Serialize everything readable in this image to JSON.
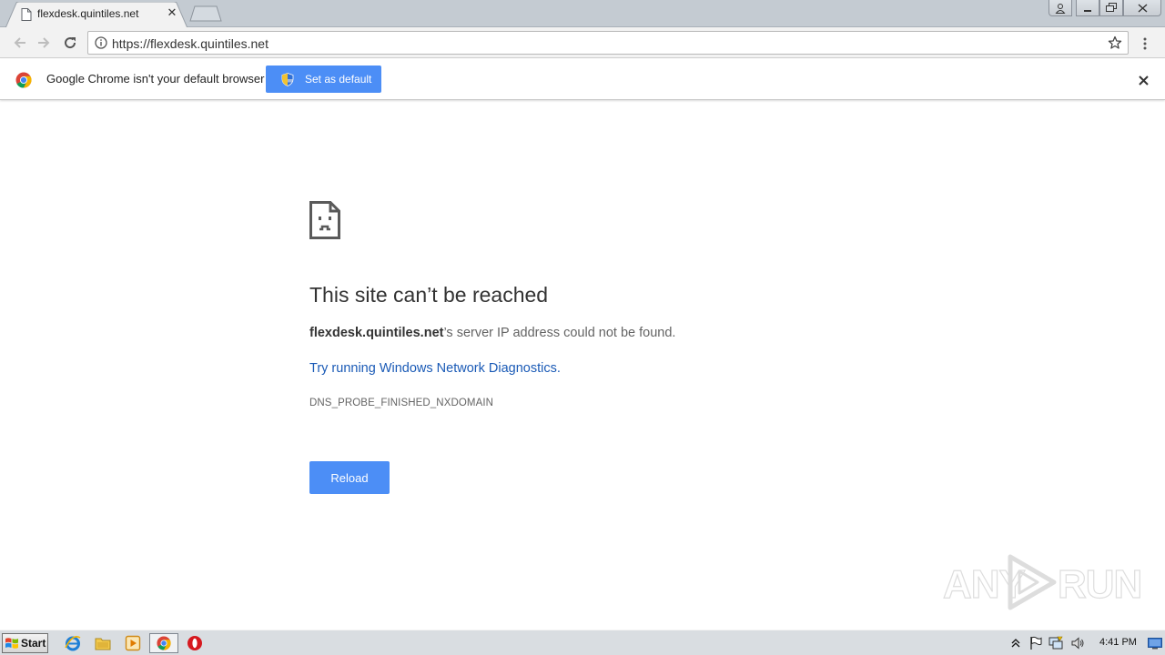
{
  "browser": {
    "tab": {
      "title": "flexdesk.quintiles.net",
      "close_glyph": "✕",
      "icon": "document-icon"
    },
    "new_tab_icon": "new-tab-icon",
    "address_bar": {
      "url": "https://flexdesk.quintiles.net",
      "security_icon": "info-icon",
      "bookmark_icon": "star-icon"
    },
    "window_controls": [
      "user-icon",
      "minimize-icon",
      "restore-icon",
      "close-icon"
    ]
  },
  "infobar": {
    "message": "Google Chrome isn't your default browser",
    "button_label": "Set as default",
    "close_glyph": "✕"
  },
  "error_page": {
    "icon": "sad-page-icon",
    "heading": "This site can’t be reached",
    "host": "flexdesk.quintiles.net",
    "summary_rest": "’s server IP address could not be found.",
    "diagnostics_link": "Try running Windows Network Diagnostics.",
    "error_code": "DNS_PROBE_FINISHED_NXDOMAIN",
    "reload_label": "Reload"
  },
  "watermark": {
    "text_left": "ANY",
    "text_right": "RUN"
  },
  "taskbar": {
    "start_label": "Start",
    "pinned": [
      "internet-explorer-icon",
      "file-explorer-icon",
      "media-player-icon",
      "chrome-icon",
      "opera-icon"
    ],
    "tray": [
      "show-hidden-icons",
      "action-center-flag-icon",
      "network-icon",
      "volume-icon"
    ],
    "clock": "4:41 PM"
  },
  "colors": {
    "accent_button": "#4c8ef6",
    "link": "#1a5ab6",
    "tabstrip": "#c4cbd2",
    "taskbar": "#d9dde1"
  }
}
